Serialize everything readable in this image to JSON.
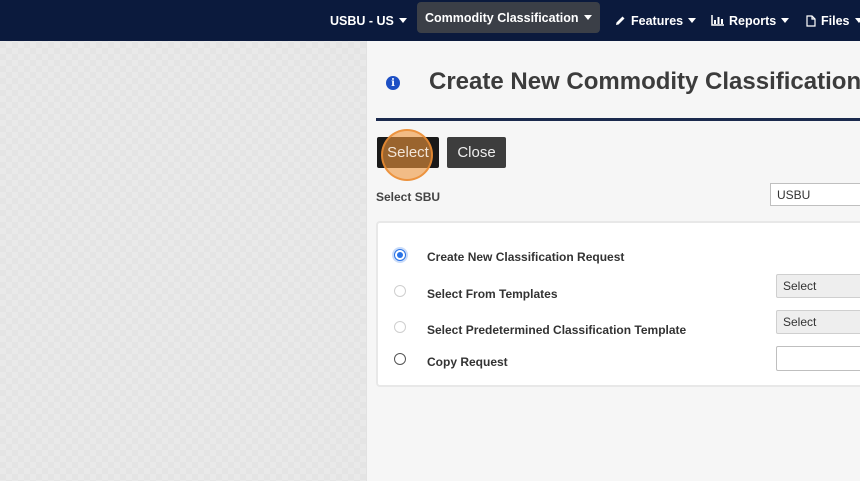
{
  "nav": {
    "sbu": "USBU - US",
    "commodity": "Commodity Classification",
    "features": "Features",
    "reports": "Reports",
    "files": "Files"
  },
  "page": {
    "title": "Create New Commodity Classification",
    "info_icon": "i"
  },
  "buttons": {
    "select": "Select",
    "close": "Close"
  },
  "sbu": {
    "label": "Select SBU",
    "value": "USBU"
  },
  "options": [
    {
      "label": "Create New Classification Request",
      "checked": true
    },
    {
      "label": "Select From Templates",
      "control_value": "Select"
    },
    {
      "label": "Select Predetermined Classification Template",
      "control_value": "Select"
    },
    {
      "label": "Copy Request",
      "control_value": ""
    }
  ],
  "colors": {
    "nav_bg": "#0b1a3d",
    "active_tab": "#3b3f47",
    "title_rule": "#1b2a4e",
    "radio_checked": "#2a73e6",
    "click_highlight": "#f0963c"
  }
}
